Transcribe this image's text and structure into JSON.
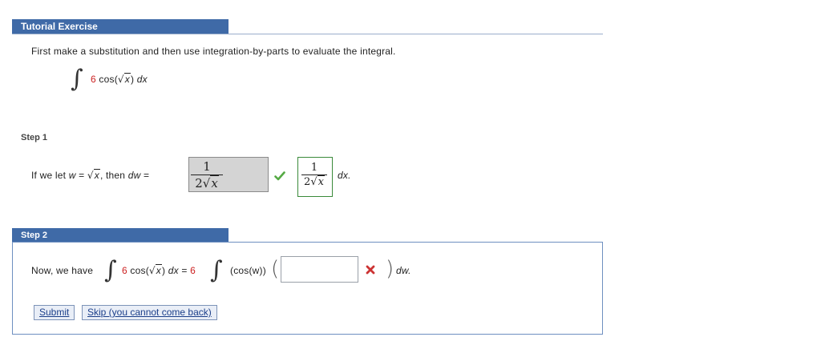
{
  "tutorial": {
    "title": "Tutorial Exercise",
    "instruction": "First make a substitution and then use integration-by-parts to evaluate the integral.",
    "integral": {
      "coefficient": "6",
      "func_open": "cos(",
      "radicand": "x",
      "func_close": ")",
      "differential": "dx"
    }
  },
  "step1": {
    "label": "Step 1",
    "prefix": "If we let",
    "w_var": "w",
    "eq": "=",
    "radicand": "x",
    "then_text": ", then",
    "dw_var": "dw",
    "eq2": "=",
    "entered_numerator": "1",
    "entered_denominator_coef": "2",
    "entered_radicand": "x",
    "answer_numerator": "1",
    "answer_denominator_coef": "2",
    "answer_radicand": "x",
    "suffix": "dx."
  },
  "step2": {
    "label": "Step 2",
    "prefix": "Now, we have",
    "coefficient": "6",
    "func_open": "cos(",
    "radicand": "x",
    "func_close": ")",
    "differential": "dx",
    "equals": "=",
    "coefficient2": "6",
    "inner": "(cos(w))",
    "input_value": "",
    "suffix": "dw."
  },
  "buttons": {
    "submit": "Submit",
    "skip": "Skip (you cannot come back)"
  },
  "colors": {
    "header_bg": "#3f6aa7",
    "coefficient_red": "#cc2222",
    "check_green": "#55aa44",
    "x_red": "#cc3333"
  }
}
